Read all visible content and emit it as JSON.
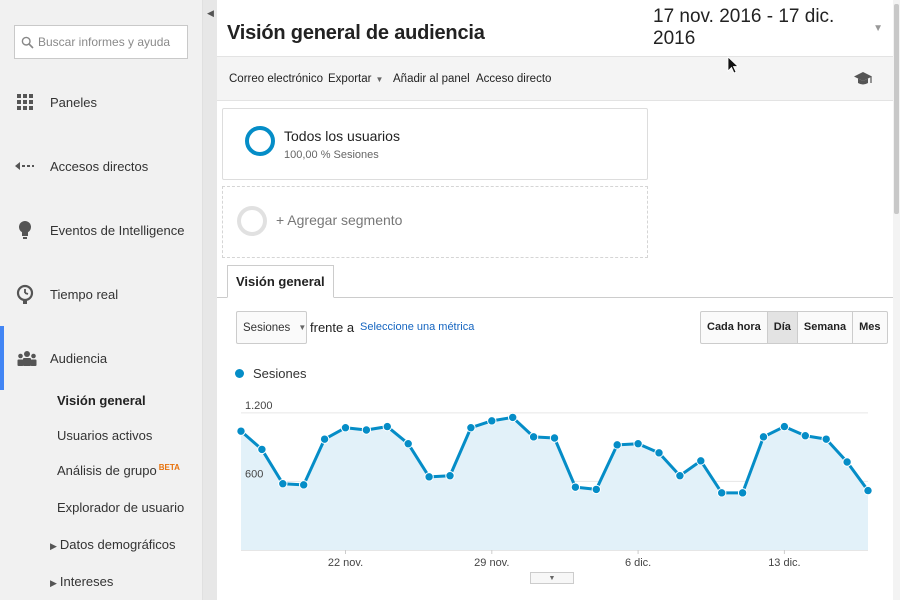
{
  "sidebar": {
    "search_placeholder": "Buscar informes y ayuda",
    "items": [
      {
        "label": "Paneles",
        "icon": "dashboard-icon"
      },
      {
        "label": "Accesos directos",
        "icon": "shortcut-icon"
      },
      {
        "label": "Eventos de Intelligence",
        "icon": "lightbulb-icon"
      },
      {
        "label": "Tiempo real",
        "icon": "clock-icon"
      },
      {
        "label": "Audiencia",
        "icon": "people-icon"
      }
    ],
    "sub_items": [
      {
        "label": "Visión general",
        "active": true
      },
      {
        "label": "Usuarios activos"
      },
      {
        "label": "Análisis de grupo",
        "badge": "BETA"
      },
      {
        "label": "Explorador de usuario"
      },
      {
        "label": "Datos demográficos",
        "expandable": true
      },
      {
        "label": "Intereses",
        "expandable": true
      }
    ]
  },
  "header": {
    "title": "Visión general de audiencia",
    "date_range": "17 nov. 2016 - 17 dic. 2016"
  },
  "toolbar": {
    "email": "Correo electrónico",
    "export": "Exportar",
    "add_to_dashboard": "Añadir al panel",
    "shortcut": "Acceso directo"
  },
  "segments": {
    "all_users": "Todos los usuarios",
    "all_users_sub": "100,00 % Sesiones",
    "add": "+ Agregar segmento"
  },
  "tab": "Visión general",
  "controls": {
    "metric": "Sesiones",
    "versus": "frente a",
    "pick_metric": "Seleccione una métrica",
    "granularity": [
      "Cada hora",
      "Día",
      "Semana",
      "Mes"
    ],
    "granularity_selected": "Día"
  },
  "colors": {
    "series": "#058dc7",
    "area": "#e2f1f9",
    "accent": "#4285f4"
  },
  "chart_data": {
    "type": "area",
    "legend": [
      "Sesiones"
    ],
    "y_tick_labels": [
      "1.200",
      "600"
    ],
    "y_ticks": [
      1200,
      600
    ],
    "ylim": [
      0,
      1400
    ],
    "x_tick_labels": [
      "22 nov.",
      "29 nov.",
      "6 dic.",
      "13 dic."
    ],
    "x_tick_dates": [
      "2016-11-22",
      "2016-11-29",
      "2016-12-06",
      "2016-12-13"
    ],
    "x": [
      "2016-11-17",
      "2016-11-18",
      "2016-11-19",
      "2016-11-20",
      "2016-11-21",
      "2016-11-22",
      "2016-11-23",
      "2016-11-24",
      "2016-11-25",
      "2016-11-26",
      "2016-11-27",
      "2016-11-28",
      "2016-11-29",
      "2016-11-30",
      "2016-12-01",
      "2016-12-02",
      "2016-12-03",
      "2016-12-04",
      "2016-12-05",
      "2016-12-06",
      "2016-12-07",
      "2016-12-08",
      "2016-12-09",
      "2016-12-10",
      "2016-12-11",
      "2016-12-12",
      "2016-12-13",
      "2016-12-14",
      "2016-12-15",
      "2016-12-16",
      "2016-12-17"
    ],
    "series": [
      {
        "name": "Sesiones",
        "values": [
          1040,
          880,
          580,
          570,
          970,
          1070,
          1050,
          1080,
          930,
          640,
          650,
          1070,
          1130,
          1160,
          990,
          980,
          550,
          530,
          920,
          930,
          850,
          650,
          780,
          500,
          500,
          990,
          1080,
          1000,
          970,
          770,
          520
        ]
      }
    ]
  }
}
